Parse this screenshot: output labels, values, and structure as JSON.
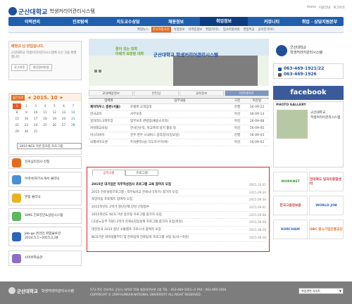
{
  "header": {
    "uni": "군산대학교",
    "sys": "학생커리어관리시스템",
    "toplinks": [
      "Home",
      "이용안내",
      "로그아웃"
    ]
  },
  "nav": [
    "이력관리",
    "진로탐색",
    "지도교수상담",
    "채용정보",
    "취업정보",
    "커뮤니티",
    "취업 · 상담지원본부"
  ],
  "subnav": [
    "취업뉴스",
    "한국직업사전",
    "직업정보",
    "자격증정보",
    "취업가이드",
    "입사지원서류",
    "면접특공",
    "공모전가이드"
  ],
  "login": {
    "welcome_name": "배정규",
    "welcome_rest": " 님 반갑습니다.",
    "desc": "군산대학교 학생커리어관리시스템에 오신 것을 환영합니다.",
    "btn_logout": "로그아웃",
    "btn_info": "개인정보변경"
  },
  "calendar": {
    "tag": "월간일정",
    "month": "2015. 10",
    "days": [
      "1",
      "2",
      "3",
      "4",
      "5",
      "6",
      "7",
      "8",
      "9",
      "10",
      "11",
      "12",
      "13",
      "14",
      "15",
      "16",
      "17",
      "18",
      "19",
      "20",
      "21",
      "22",
      "23",
      "24",
      "25",
      "26",
      "27",
      "28",
      "29",
      "30",
      "31"
    ],
    "popup": "2015 NCS 기반 잡코칭 프로그램"
  },
  "left_menu": [
    {
      "label": "진로심리검사 신청"
    },
    {
      "label": "이력서/자기소개서 클리닉"
    },
    {
      "label": "면접 클리닉"
    },
    {
      "label": "SIMS 진로진단&상담시스템"
    },
    {
      "label": "Job-go 온라인 취업솔루션\n2014.5.1~2015.2.28"
    },
    {
      "label": "사이버학습관"
    }
  ],
  "banner": {
    "tagline": "꿈이 있는 대학\n미래가 보장된 대학",
    "name": "군산대학교 학생커리어관리시스템"
  },
  "job_tabs": [
    "교내채용정보",
    "인턴십",
    "교육정보",
    "아르바이트"
  ],
  "job_table": {
    "headers": [
      "업체명",
      "업무내용",
      "구분",
      "마감일"
    ],
    "rows": [
      [
        "제이하우스 총판(서울)",
        "호텔퀵 고객응대",
        "진행",
        "16-09-22"
      ],
      [
        "한국교미",
        "사무보조",
        "마감",
        "16-09-14"
      ],
      [
        "일자리G.S파트장",
        "업무보조 관련업(채용소지자)",
        "마감",
        "16-09-08"
      ],
      [
        "커밍래교육팀",
        "한국단순직, 학교폭력 방지 활동 등",
        "마감",
        "16-09-05"
      ],
      [
        "비스타바이",
        "전주 완주 시내버스 길라잡이(일요일)",
        "진행",
        "16-09-03"
      ],
      [
        "국제바이오랜",
        "주차판리(남) 다도토우미(여)",
        "마감",
        "16-09-02"
      ]
    ]
  },
  "notice": {
    "tabs": [
      "공지사항",
      "프로그램"
    ],
    "items": [
      {
        "title": "2015년 대기업만 직무적성검사 프로그램 교육 참여자 모집",
        "date": "2015.10.01",
        "bold": true
      },
      {
        "title": "2015 진로설정프로그램 - 직무&비교 진로(4-5학기) 참가자 모집",
        "date": "2015.09.30",
        "bold": false
      },
      {
        "title": "희망이음 프로젝트 참여자 모집",
        "date": "2015.09.30",
        "bold": false
      },
      {
        "title": "2015학년도 2학기 청년인재 양성 신청접수",
        "date": "2015.09.01",
        "bold": false
      },
      {
        "title": "2015학년도 NCS 기반 잡코칭 프로그램 참가자 모집",
        "date": "2015.09.08",
        "bold": false
      },
      {
        "title": "[고용노동부 지원] 2학기 진로&직업설계 프로그램 참가자 모집(마감)",
        "date": "2015.09.08",
        "bold": false
      },
      {
        "title": "대전진국 2015 청년 소통캠프 크로스비 참여자 모집",
        "date": "2015.08.28",
        "bold": false
      },
      {
        "title": "NCS기반 대학생활부터 및 진로탐색 진로탐색 프로그램 사업 실시(~마감)",
        "date": "2015.08.28",
        "bold": false
      }
    ]
  },
  "right": {
    "uni": "군산대학교",
    "sys": "학생커리어관리시스템",
    "tel": "063-469-1921/22",
    "fax": "063-469-1926",
    "facebook": "facebook",
    "gallery_title": "PHOTO GALLERY",
    "gallery_caption": "군산대학교\n학생커리어관리시스템",
    "links": [
      [
        "WORKNET",
        "전라북도 일자리종합센터"
      ],
      [
        "한국고용정보원",
        "WORLD JOB"
      ],
      [
        "KORCHAM",
        "SBC 중소기업진흥공단"
      ]
    ]
  },
  "footer": {
    "uni": "군산대학교",
    "sys": "학생커리어관리시스템",
    "addr": "573-701 전라북도 군산시 대학로 558 재정대학본관 2층 TEL : 063-469-1921~2 FAX : 063-469-1926",
    "copy": "COPYRIGHT © 2009 KUNSAN NATIONAL UNIVERSITY. ALL RIGHT RESERVED.",
    "select": "취업관련 사이트"
  },
  "colors": {
    "brand": "#1f5fad",
    "accent": "#e46b1c",
    "notice_border": "#dd2222"
  }
}
